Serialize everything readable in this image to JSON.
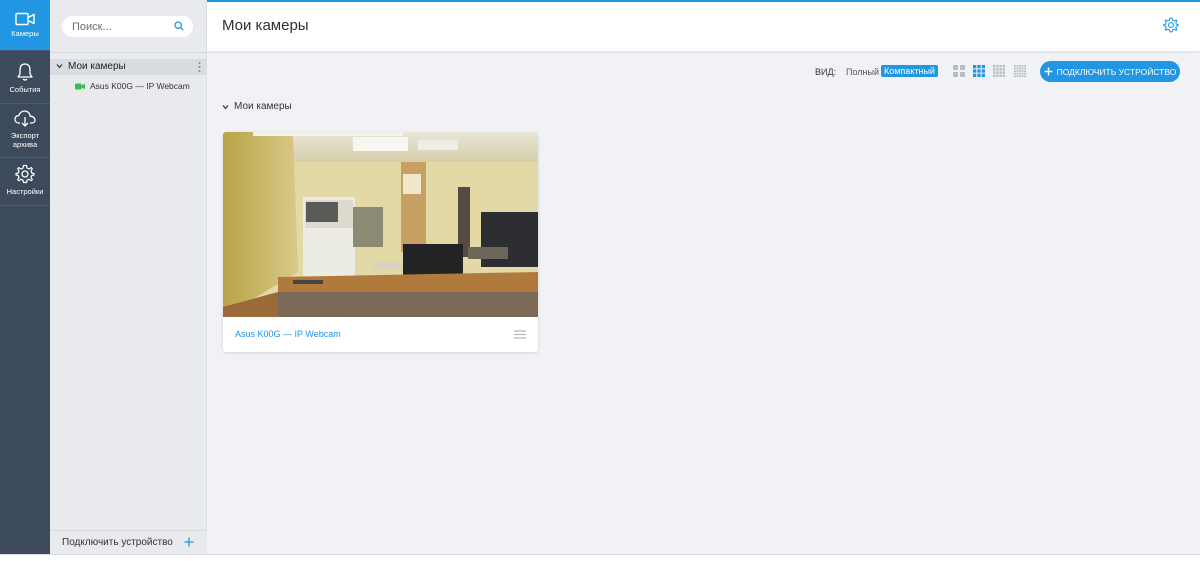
{
  "nav": {
    "items": [
      {
        "label": "Камеры",
        "icon": "video-camera-icon",
        "active": true
      },
      {
        "label": "События",
        "icon": "bell-icon",
        "active": false
      },
      {
        "label": "Экспорт архива",
        "icon": "cloud-download-icon",
        "active": false
      },
      {
        "label": "Настройки",
        "icon": "gear-icon",
        "active": false
      }
    ]
  },
  "sidebar": {
    "search_placeholder": "Поиск...",
    "group_label": "Мои камеры",
    "camera_label": "Asus K00G — IP Webcam",
    "footer_label": "Подключить устройство"
  },
  "header": {
    "title": "Мои камеры"
  },
  "toolbar": {
    "view_label": "ВИД:",
    "view_full": "Полный",
    "view_compact": "Компактный",
    "connect_label": "ПОДКЛЮЧИТЬ УСТРОЙСТВО"
  },
  "main": {
    "section_title": "Мои камеры",
    "cards": [
      {
        "title": "Asus K00G — IP Webcam"
      }
    ]
  },
  "colors": {
    "accent": "#2196e3",
    "rail": "#3d4a5c",
    "camera_online": "#3bbf4a"
  }
}
